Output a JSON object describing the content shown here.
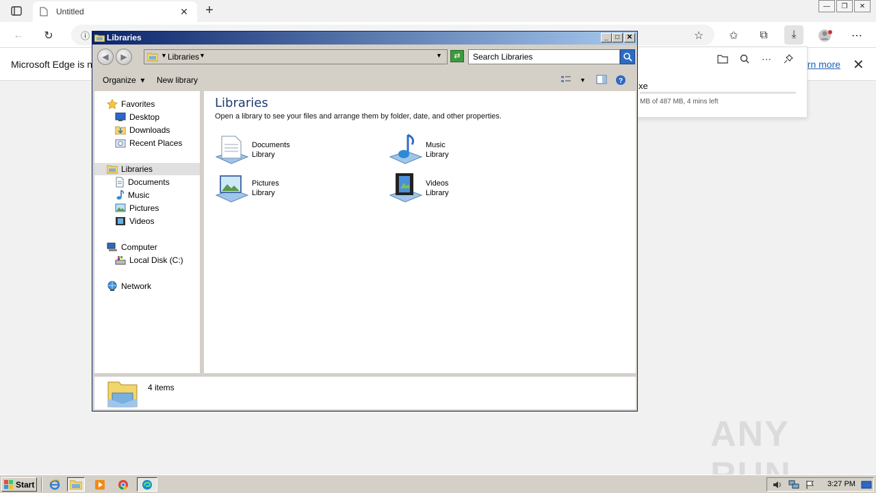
{
  "browser": {
    "tab_title": "Untitled",
    "infobar_text": "Microsoft Edge is no",
    "infobar_link": "arn more",
    "download": {
      "file_fragment": "xe",
      "status": "MB of 487 MB, 4 mins left",
      "progress": 0
    }
  },
  "explorer": {
    "title": "Libraries",
    "address": "Libraries",
    "search_placeholder": "Search Libraries",
    "commands": {
      "organize": "Organize",
      "new_library": "New library"
    },
    "nav": {
      "favorites": "Favorites",
      "desktop": "Desktop",
      "downloads": "Downloads",
      "recent_places": "Recent Places",
      "libraries": "Libraries",
      "documents": "Documents",
      "music": "Music",
      "pictures": "Pictures",
      "videos": "Videos",
      "computer": "Computer",
      "local_disk": "Local Disk (C:)",
      "network": "Network"
    },
    "content": {
      "heading": "Libraries",
      "subheading": "Open a library to see your files and arrange them by folder, date, and other properties.",
      "libraries": [
        {
          "name": "Documents",
          "type": "Library"
        },
        {
          "name": "Music",
          "type": "Library"
        },
        {
          "name": "Pictures",
          "type": "Library"
        },
        {
          "name": "Videos",
          "type": "Library"
        }
      ]
    },
    "status": "4 items"
  },
  "taskbar": {
    "start_label": "Start",
    "clock": "3:27 PM"
  },
  "watermark": "ANY RUN"
}
